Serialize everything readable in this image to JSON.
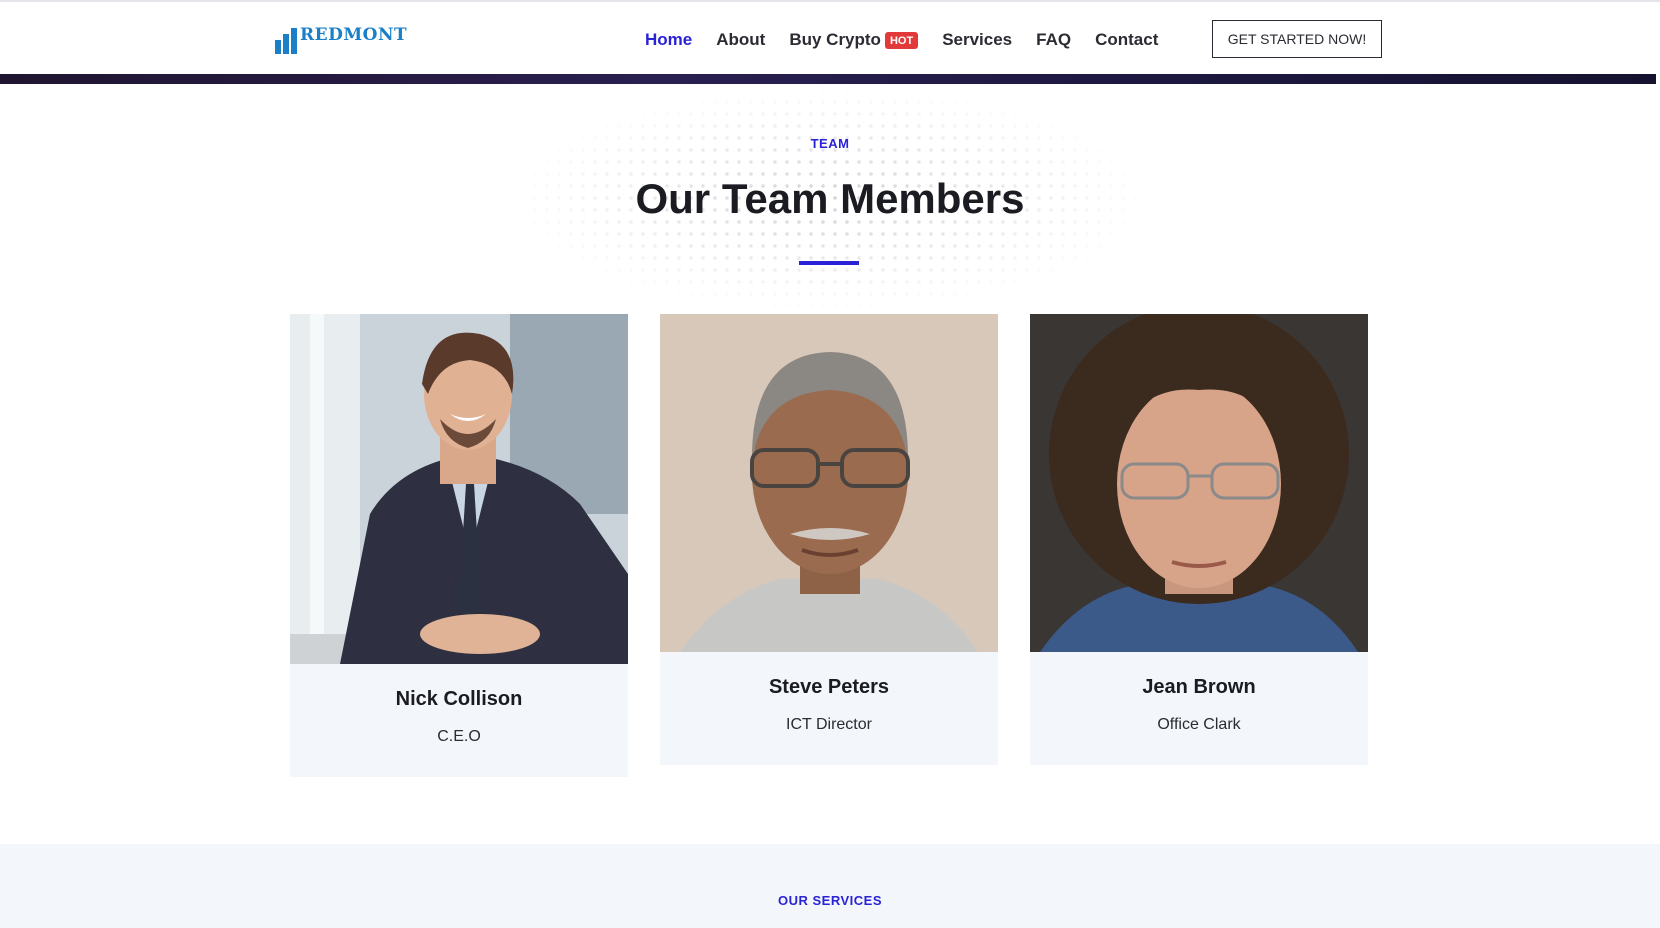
{
  "header": {
    "logo_text": "REDMONT",
    "nav": [
      {
        "label": "Home",
        "active": true
      },
      {
        "label": "About"
      },
      {
        "label": "Buy Crypto",
        "badge": "HOT"
      },
      {
        "label": "Services"
      },
      {
        "label": "FAQ"
      },
      {
        "label": "Contact"
      }
    ],
    "cta_label": "GET STARTED NOW!"
  },
  "team": {
    "eyebrow": "TEAM",
    "title": "Our Team Members",
    "members": [
      {
        "name": "Nick Collison",
        "role": "C.E.O",
        "photo": "man-in-suit-smiling-photo"
      },
      {
        "name": "Steve Peters",
        "role": "ICT Director",
        "photo": "older-man-with-glasses-photo"
      },
      {
        "name": "Jean Brown",
        "role": "Office Clark",
        "photo": "woman-with-glasses-photo"
      }
    ]
  },
  "services": {
    "eyebrow": "OUR SERVICES"
  },
  "colors": {
    "accent": "#2a23d6",
    "brand": "#1a7fc6",
    "badge": "#e23a3a",
    "card_bg": "#f3f7fc"
  }
}
